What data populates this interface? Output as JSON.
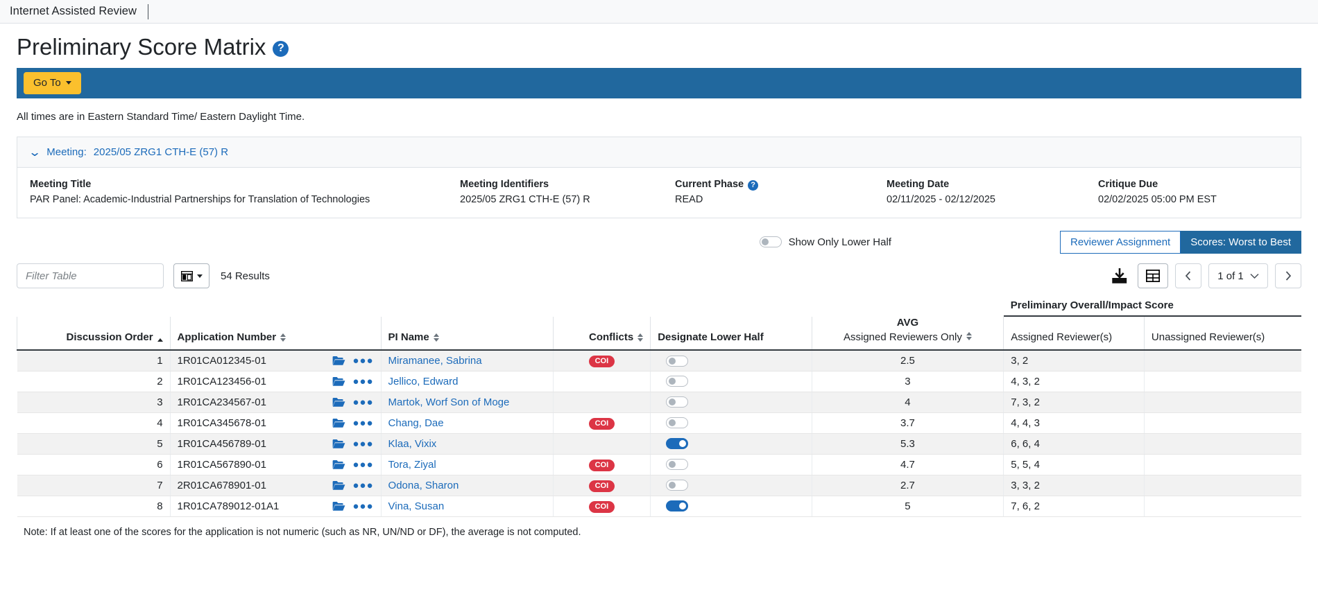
{
  "appbar": {
    "title": "Internet Assisted Review"
  },
  "page": {
    "title": "Preliminary Score Matrix",
    "help_icon": "help-circle-icon",
    "timezone_note": "All times are in Eastern Standard Time/ Eastern Daylight Time.",
    "footnote": "Note: If at least one of the scores for the application is not numeric (such as NR, UN/ND or DF), the average is not computed."
  },
  "actionbar": {
    "goto_label": "Go To"
  },
  "meeting": {
    "collapse_label": "Meeting:",
    "collapse_value": "2025/05 ZRG1 CTH-E (57) R",
    "fields": {
      "title_label": "Meeting Title",
      "title_value": "PAR Panel: Academic-Industrial Partnerships for Translation of Technologies",
      "identifiers_label": "Meeting Identifiers",
      "identifiers_value": "2025/05 ZRG1 CTH-E (57) R",
      "phase_label": "Current Phase",
      "phase_value": "READ",
      "date_label": "Meeting Date",
      "date_value": "02/11/2025 - 02/12/2025",
      "critique_label": "Critique Due",
      "critique_value": "02/02/2025 05:00 PM EST"
    }
  },
  "controls": {
    "show_lower_half_label": "Show Only Lower Half",
    "show_lower_half_on": false,
    "view_buttons": [
      {
        "label": "Reviewer Assignment",
        "active": false
      },
      {
        "label": "Scores: Worst to Best",
        "active": true
      }
    ],
    "filter_placeholder": "Filter Table",
    "filter_value": "",
    "column_picker_icon": "columns-icon",
    "results_count": "54 Results",
    "download_icon": "download-icon",
    "grid_view_icon": "grid-icon",
    "prev_icon": "chevron-left-icon",
    "next_icon": "chevron-right-icon",
    "page_label": "1 of 1"
  },
  "table": {
    "group_header": "Preliminary Overall/Impact Score",
    "columns": {
      "discussion_order": "Discussion Order",
      "application_number": "Application Number",
      "pi_name": "PI Name",
      "conflicts": "Conflicts",
      "designate_lower_half": "Designate Lower Half",
      "avg_top": "AVG",
      "avg_bottom": "Assigned Reviewers Only",
      "assigned_reviewers": "Assigned Reviewer(s)",
      "unassigned_reviewers": "Unassigned Reviewer(s)"
    },
    "sort": {
      "column": "Discussion Order",
      "direction": "asc"
    },
    "rows": [
      {
        "order": "1",
        "app": "1R01CA012345-01",
        "pi": "Miramanee, Sabrina",
        "coi": "COI",
        "lower_half": false,
        "avg": "2.5",
        "assigned": "3, 2",
        "unassigned": ""
      },
      {
        "order": "2",
        "app": "1R01CA123456-01",
        "pi": "Jellico, Edward",
        "coi": "",
        "lower_half": false,
        "avg": "3",
        "assigned": "4, 3, 2",
        "unassigned": ""
      },
      {
        "order": "3",
        "app": "1R01CA234567-01",
        "pi": "Martok, Worf Son of Moge",
        "coi": "",
        "lower_half": false,
        "avg": "4",
        "assigned": "7, 3, 2",
        "unassigned": ""
      },
      {
        "order": "4",
        "app": "1R01CA345678-01",
        "pi": "Chang, Dae",
        "coi": "COI",
        "lower_half": false,
        "avg": "3.7",
        "assigned": "4, 4, 3",
        "unassigned": ""
      },
      {
        "order": "5",
        "app": "1R01CA456789-01",
        "pi": "Klaa, Vixix",
        "coi": "",
        "lower_half": true,
        "avg": "5.3",
        "assigned": "6, 6, 4",
        "unassigned": ""
      },
      {
        "order": "6",
        "app": "1R01CA567890-01",
        "pi": "Tora, Ziyal",
        "coi": "COI",
        "lower_half": false,
        "avg": "4.7",
        "assigned": "5, 5, 4",
        "unassigned": ""
      },
      {
        "order": "7",
        "app": "2R01CA678901-01",
        "pi": "Odona, Sharon",
        "coi": "COI",
        "lower_half": false,
        "avg": "2.7",
        "assigned": "3, 3, 2",
        "unassigned": ""
      },
      {
        "order": "8",
        "app": "1R01CA789012-01A1",
        "pi": "Vina, Susan",
        "coi": "COI",
        "lower_half": true,
        "avg": "5",
        "assigned": "7, 6, 2",
        "unassigned": ""
      }
    ]
  },
  "colors": {
    "accent_blue": "#21689e",
    "link_blue": "#1c6bba",
    "goto_yellow": "#fbc02d",
    "coi_red": "#dc3545"
  }
}
